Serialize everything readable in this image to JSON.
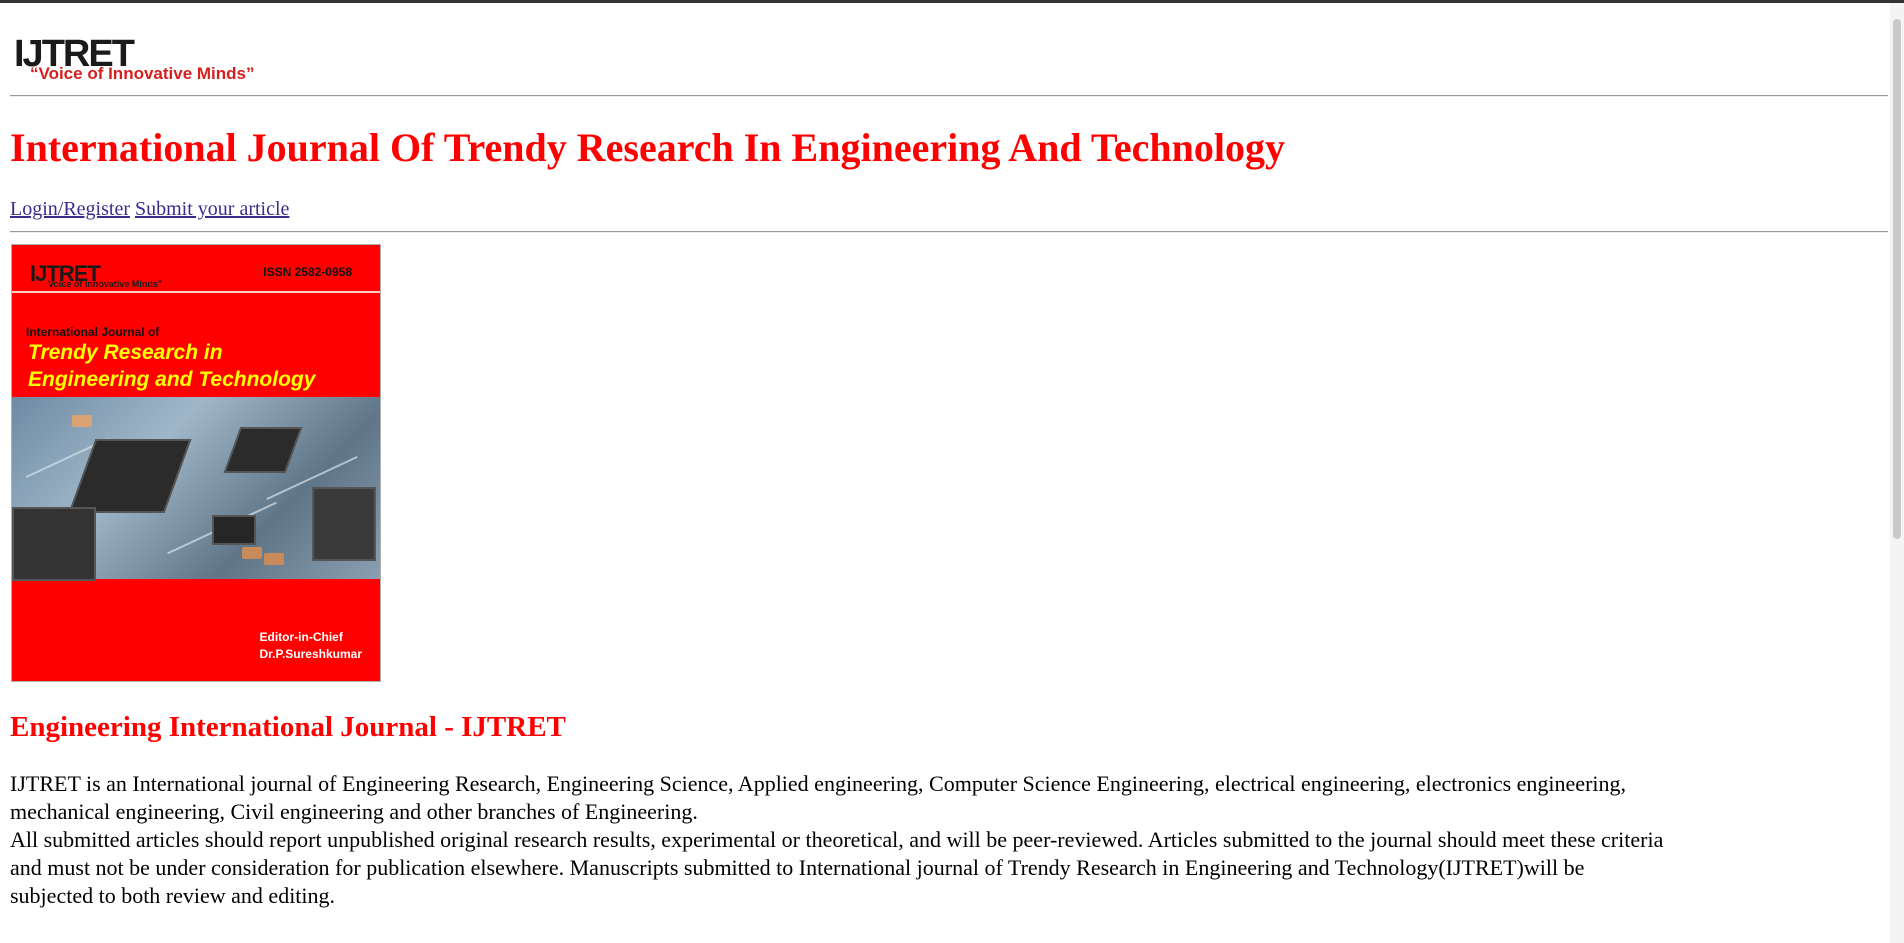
{
  "site": {
    "logo_text": "IJTRET",
    "logo_tagline": "“Voice of Innovative Minds”"
  },
  "header": {
    "title": "International Journal Of Trendy Research In Engineering And Technology"
  },
  "nav": {
    "login_label": "Login/Register",
    "submit_label": "Submit your article"
  },
  "cover": {
    "logo_text": "IJTRET",
    "logo_tagline": "Voice of Innovative Minds\"",
    "issn": "ISSN 2582-0958",
    "subtitle": "International Journal of",
    "title_line1": "Trendy Research in",
    "title_line2": "Engineering and Technology",
    "editor_role": "Editor-in-Chief",
    "editor_name": "Dr.P.Sureshkumar"
  },
  "main": {
    "heading": "Engineering International Journal - IJTRET",
    "para1_line1": "IJTRET is an International journal of Engineering Research, Engineering Science, Applied engineering, Computer Science Engineering, electrical engineering, electronics engineering,",
    "para1_line2": "mechanical engineering, Civil engineering and other branches of Engineering.",
    "para2_line1": "All submitted articles should report unpublished original research results, experimental or theoretical, and will be peer-reviewed. Articles submitted to the journal should meet these criteria",
    "para2_line2": "and must not be under consideration for publication elsewhere. Manuscripts submitted to International journal of Trendy Research in Engineering and Technology(IJTRET)will be",
    "para2_line3": "subjected to both review and editing."
  }
}
